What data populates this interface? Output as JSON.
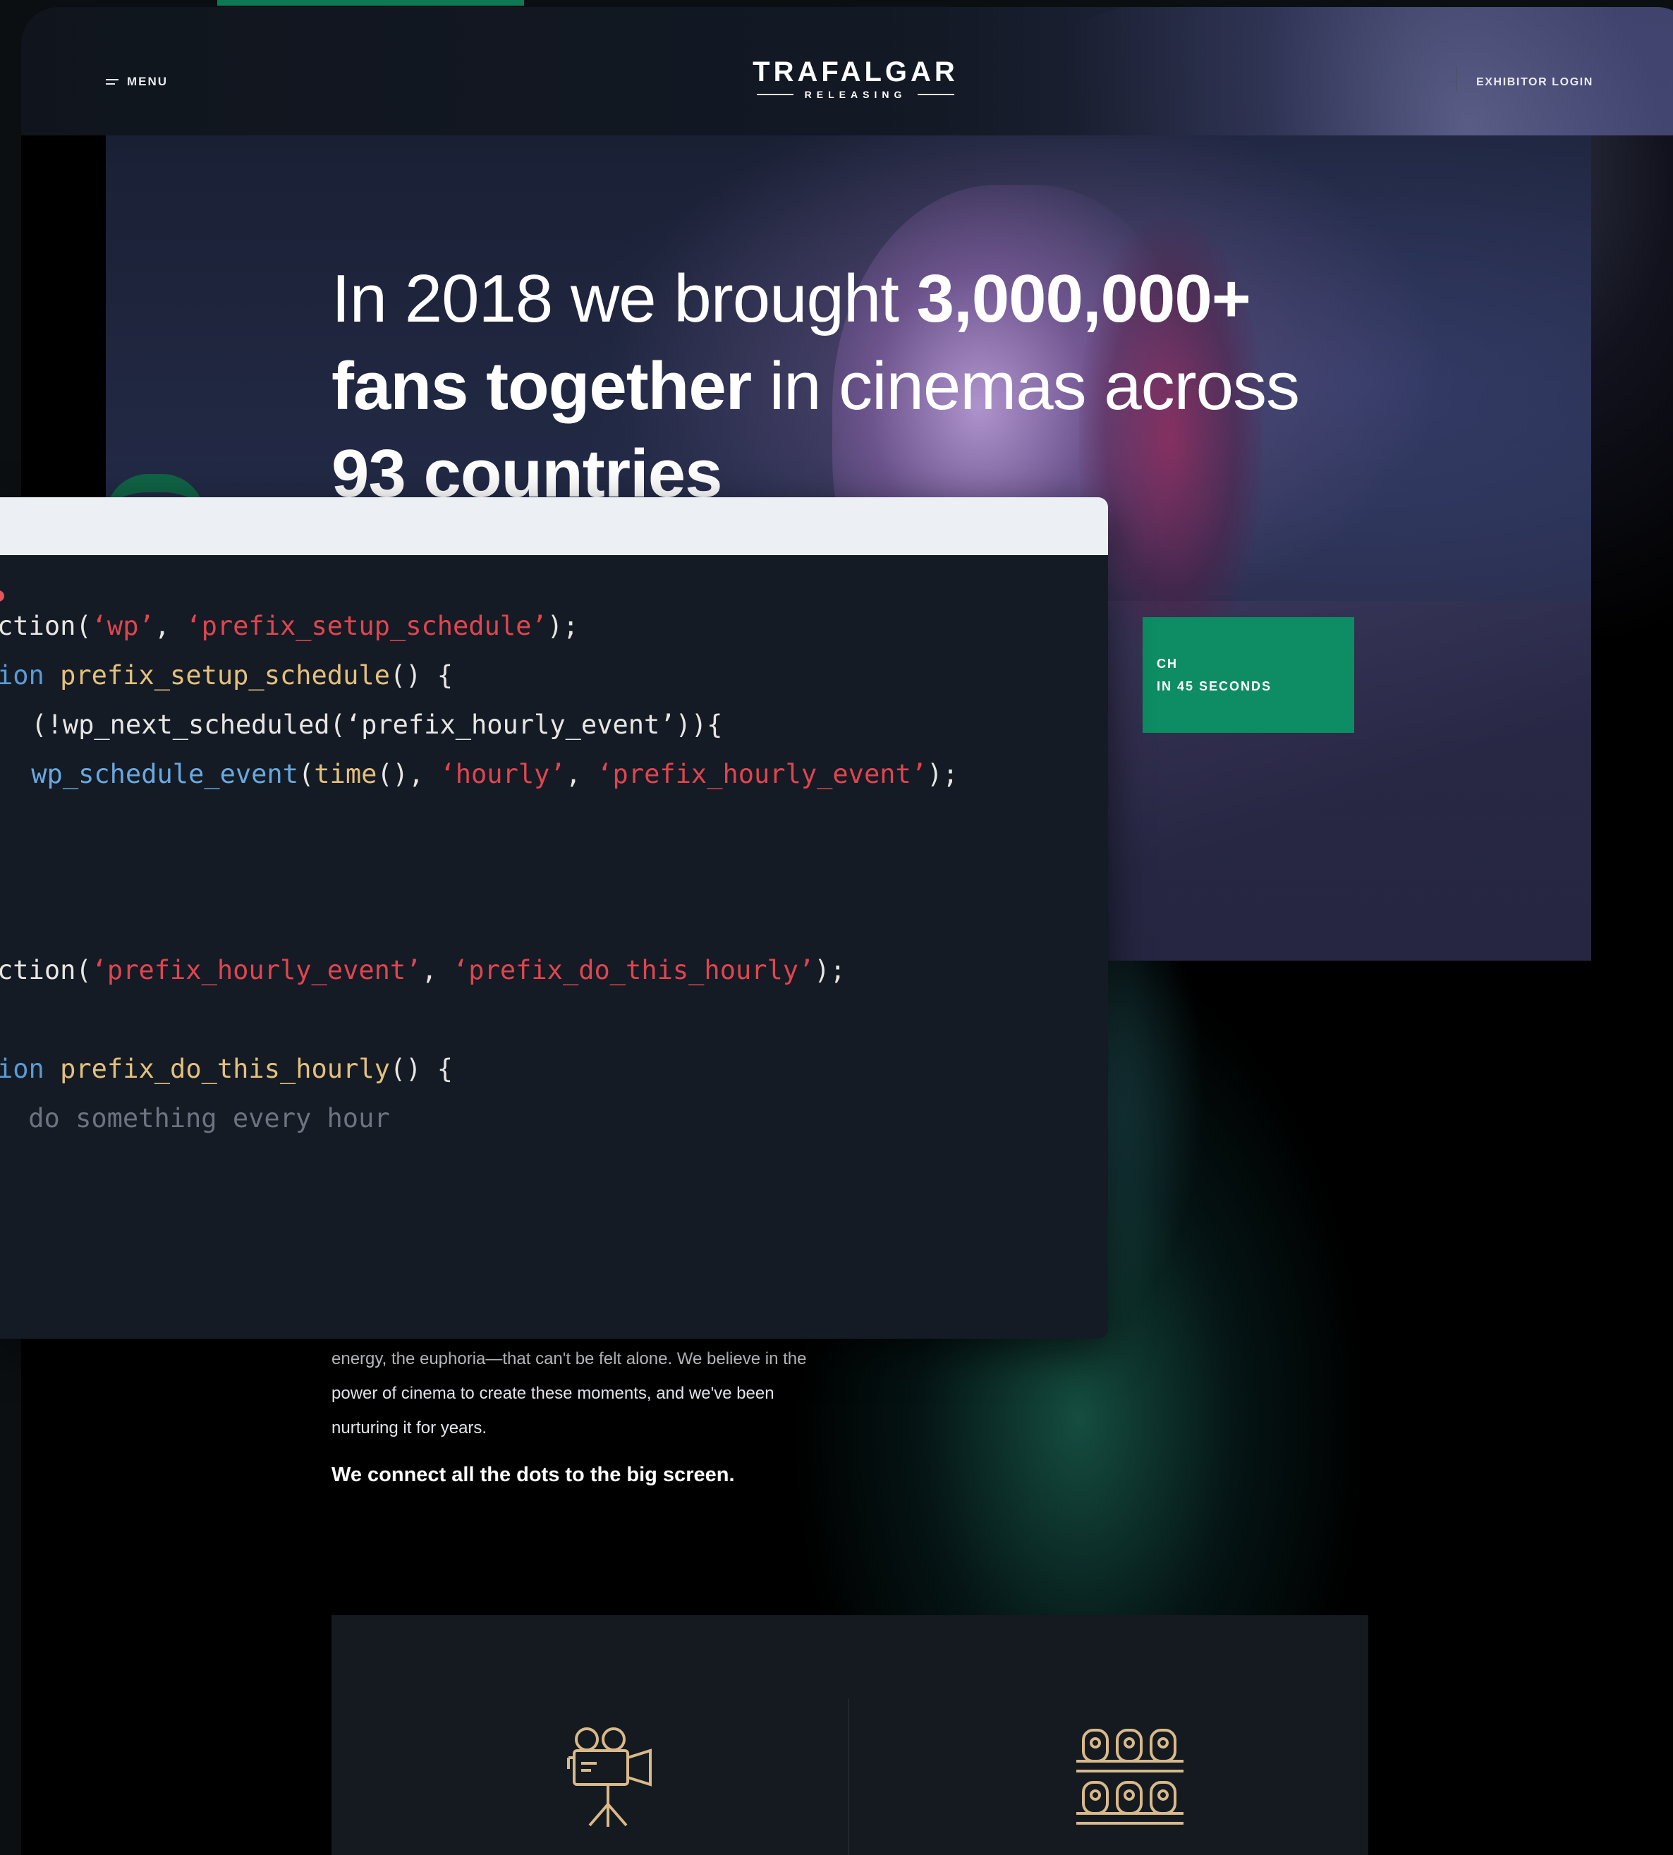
{
  "site": {
    "menu_label": "MENU",
    "logo_main": "TRAFALGAR",
    "logo_sub": "RELEASING",
    "login_label": "EXHIBITOR LOGIN"
  },
  "hero": {
    "title_part1": "In 2018 we brought ",
    "title_bold1": "3,000,000+ fans together",
    "title_part2": " in cinemas across ",
    "title_bold2": "93 countries",
    "cta_line1": "CH",
    "cta_line2": "IN 45 SECONDS"
  },
  "about": {
    "line1": "energy, the euphoria—that can't be felt alone. We believe in the",
    "line2": "power of cinema to create these moments, and we've been",
    "line3": "nurturing it for years.",
    "strong": "We connect all the dots to the big screen."
  },
  "features": {
    "icons": [
      "film-camera-icon",
      "cinema-seats-icon"
    ]
  },
  "code": {
    "lines": [
      {
        "segments": [
          [
            "ction(",
            "plain"
          ],
          [
            "‘wp’",
            "str"
          ],
          [
            ", ",
            "plain"
          ],
          [
            "‘prefix_setup_schedule’",
            "str"
          ],
          [
            ");",
            "plain"
          ]
        ]
      },
      {
        "segments": [
          [
            "ion",
            "kw"
          ],
          [
            " ",
            "plain"
          ],
          [
            "prefix_setup_schedule",
            "fn"
          ],
          [
            "() {",
            "plain"
          ]
        ]
      },
      {
        "segments": [
          [
            " (!wp_next_scheduled(‘prefix_hourly_event’)){",
            "plain"
          ]
        ]
      },
      {
        "segments": [
          [
            " ",
            "plain"
          ],
          [
            "wp_schedule_event",
            "call"
          ],
          [
            "(",
            "plain"
          ],
          [
            "time",
            "fn"
          ],
          [
            "(), ",
            "plain"
          ],
          [
            "‘hourly’",
            "str"
          ],
          [
            ", ",
            "plain"
          ],
          [
            "‘prefix_hourly_event’",
            "str"
          ],
          [
            ");",
            "plain"
          ]
        ]
      },
      {
        "segments": [
          [
            "ction(",
            "plain"
          ],
          [
            "‘prefix_hourly_event’",
            "str"
          ],
          [
            ", ",
            "plain"
          ],
          [
            "‘prefix_do_this_hourly’",
            "str"
          ],
          [
            ");",
            "plain"
          ]
        ]
      },
      {
        "segments": [
          [
            "ion",
            "kw"
          ],
          [
            " ",
            "plain"
          ],
          [
            "prefix_do_this_hourly",
            "fn"
          ],
          [
            "() {",
            "plain"
          ]
        ]
      },
      {
        "segments": [
          [
            " do something every hour",
            "com"
          ]
        ]
      }
    ]
  },
  "colors": {
    "accent_green": "#0e8c63",
    "code_bg": "#141b25",
    "string": "#e0454f",
    "keyword": "#5b9bd5",
    "function": "#e5c07b",
    "comment": "#6b7480"
  }
}
